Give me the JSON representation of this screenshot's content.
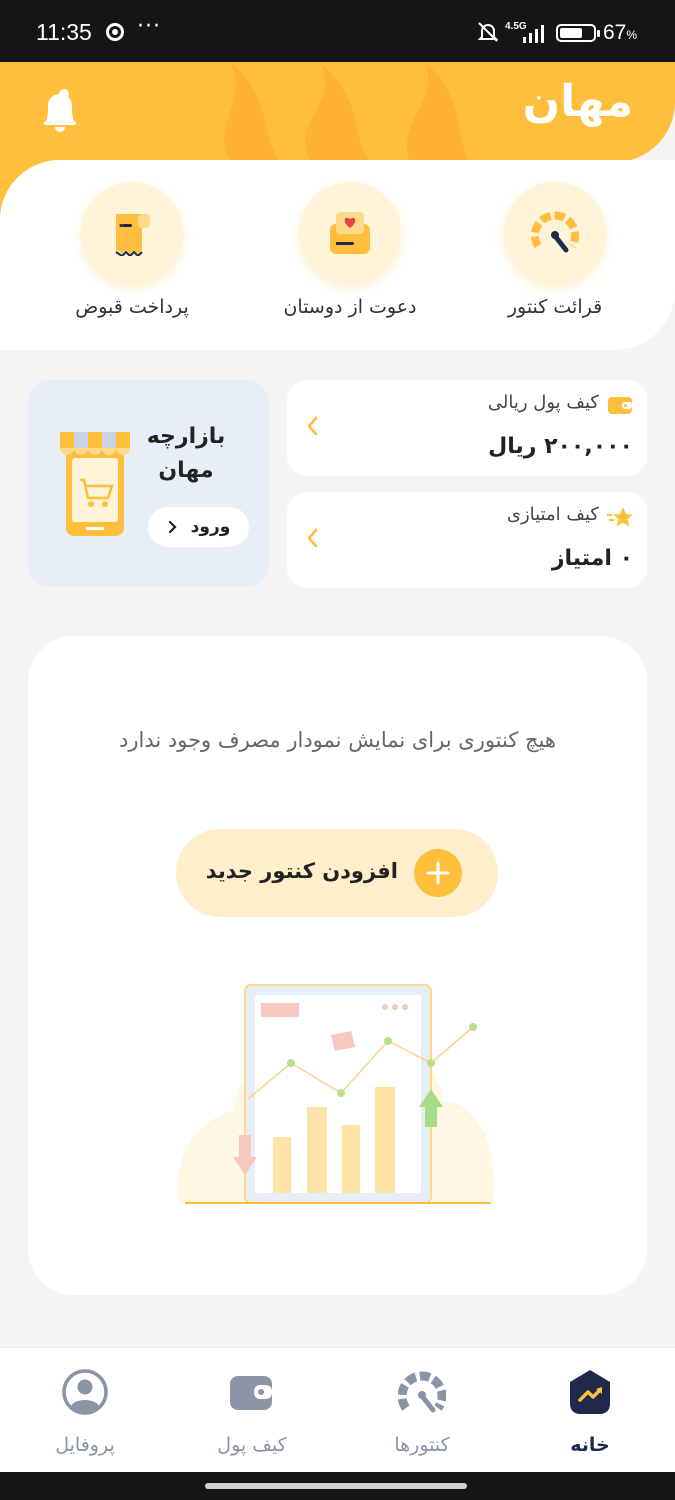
{
  "status_bar": {
    "time": "11:35",
    "dots": "···",
    "network": "4.5G",
    "battery_percent": "67",
    "percent_sign": "%"
  },
  "header": {
    "logo_text": "مهان"
  },
  "quick_actions": [
    {
      "label": "قرائت کنتور",
      "icon": "meter-gauge-icon"
    },
    {
      "label": "دعوت از دوستان",
      "icon": "invite-gift-icon"
    },
    {
      "label": "پرداخت قبوض",
      "icon": "bill-receipt-icon"
    }
  ],
  "rial_wallet": {
    "title": "کیف پول ریالی",
    "value": "۲۰۰,۰۰۰ ریال"
  },
  "points_wallet": {
    "title": "کیف امتیازی",
    "value": "۰ امتیاز"
  },
  "market": {
    "title": "بازارچه مهان",
    "button_label": "ورود"
  },
  "chart_empty": {
    "message": "هیچ کنتوری برای نمایش نمودار مصرف وجود ندارد",
    "add_button_label": "افزودن کنتور جدید"
  },
  "bottom_nav": {
    "home": "خانه",
    "meters": "کنتورها",
    "wallet": "کیف پول",
    "profile": "پروفایل"
  },
  "colors": {
    "brand_yellow": "#ffbf3c",
    "light_yellow": "#fff3d8",
    "navy": "#1f2a4a",
    "nav_gray": "#8b93a7"
  }
}
